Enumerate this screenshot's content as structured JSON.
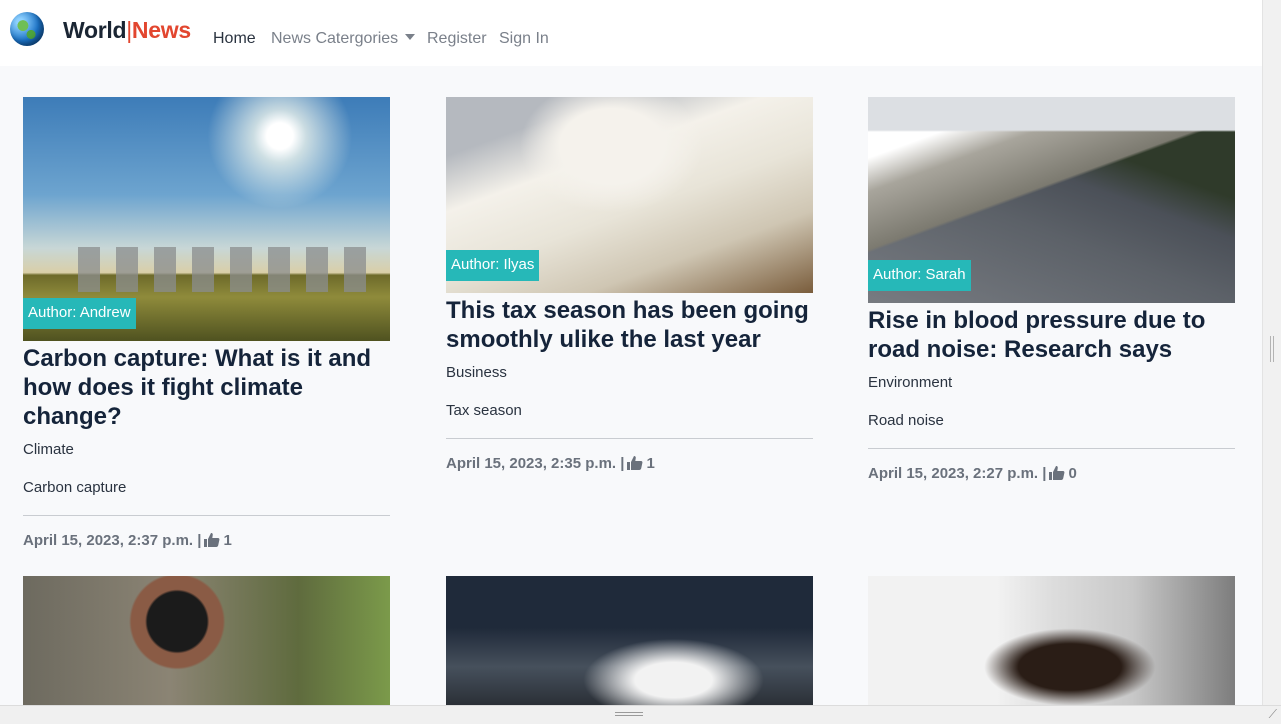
{
  "brand": {
    "part1": "World",
    "separator": "|",
    "part2": "News"
  },
  "nav": {
    "home": "Home",
    "categories": "News Catergories",
    "register": "Register",
    "sign_in": "Sign In"
  },
  "colors": {
    "accent_teal": "#26b8b8",
    "brand_red": "#e2462f",
    "navbar_bg": "#ffffff",
    "page_bg": "#f8f9fb"
  },
  "cards": [
    {
      "author": "Author: Andrew",
      "title": "Carbon capture: What is it and how does it fight climate change?",
      "category": "Climate",
      "tag": "Carbon capture",
      "date": "April 15, 2023, 2:37 p.m.",
      "likes": "1",
      "image": "power-plant-cooling-towers"
    },
    {
      "author": "Author: Ilyas",
      "title": "This tax season has been going smoothly ulike the last year",
      "category": "Business",
      "tag": "Tax season",
      "date": "April 15, 2023, 2:35 p.m.",
      "likes": "1",
      "image": "woman-filing-tax-forms"
    },
    {
      "author": "Author: Sarah",
      "title": "Rise in blood pressure due to road noise: Research says",
      "category": "Environment",
      "tag": "Road noise",
      "date": "April 15, 2023, 2:27 p.m.",
      "likes": "0",
      "image": "highway-next-to-houses"
    }
  ],
  "partial_cards": [
    {
      "image": "sewage-pipe-outflow"
    },
    {
      "image": "car-exhaust-fumes"
    },
    {
      "image": "woman-on-phone-at-office"
    }
  ],
  "icons": {
    "logo": "globe-icon",
    "like": "thumbs-up-icon",
    "dropdown": "caret-down-icon"
  }
}
